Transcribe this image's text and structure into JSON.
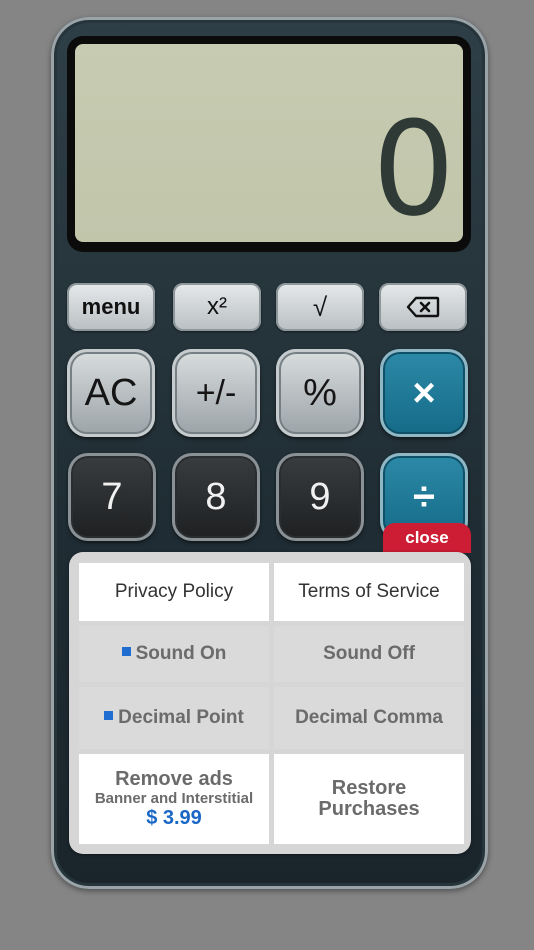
{
  "display": {
    "value": "0"
  },
  "function_row": {
    "menu": "menu",
    "square": "x²",
    "sqrt": "√",
    "backspace_icon": "backspace-icon"
  },
  "keys": {
    "ac": "AC",
    "plus_minus": "+/-",
    "percent": "%",
    "multiply": "×",
    "seven": "7",
    "eight": "8",
    "nine": "9",
    "divide": "÷"
  },
  "menu_panel": {
    "close": "close",
    "privacy": "Privacy Policy",
    "terms": "Terms of Service",
    "sound_on": "Sound On",
    "sound_off": "Sound Off",
    "decimal_point": "Decimal Point",
    "decimal_comma": "Decimal Comma",
    "remove_ads": "Remove ads",
    "remove_ads_sub": "Banner and Interstitial",
    "price": "$ 3.99",
    "restore_line1": "Restore",
    "restore_line2": "Purchases"
  },
  "colors": {
    "accent_teal": "#1b7896",
    "close_red": "#cc1d34",
    "price_blue": "#1a67c6",
    "indicator_blue": "#1f6dd0"
  }
}
